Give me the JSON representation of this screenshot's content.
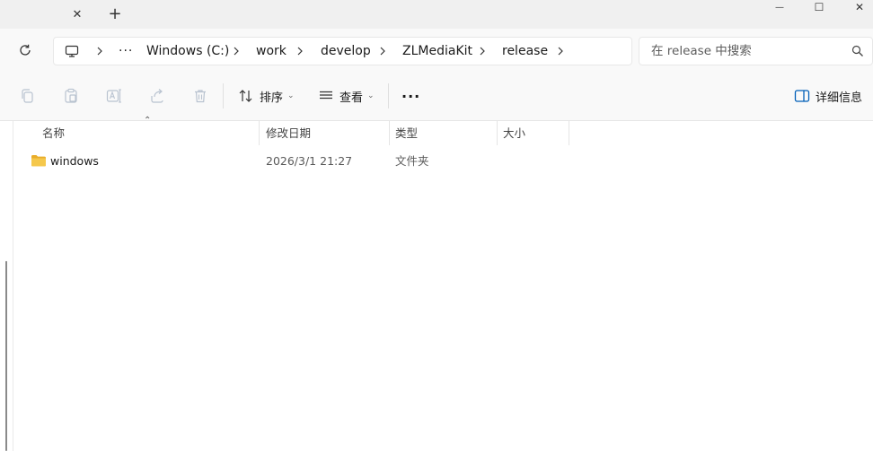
{
  "window": {
    "tab_close_glyph": "✕",
    "new_tab_glyph": "+",
    "minimize_glyph": "—",
    "maximize_glyph": "☐",
    "close_glyph": "✕"
  },
  "address": {
    "more_glyph": "···",
    "crumbs": [
      "Windows (C:)",
      "work",
      "develop",
      "ZLMediaKit",
      "release"
    ]
  },
  "search": {
    "placeholder": "在 release 中搜索"
  },
  "toolbar": {
    "sort_label": "排序",
    "view_label": "查看",
    "more_glyph": "···",
    "details_label": "详细信息"
  },
  "columns": {
    "name": "名称",
    "modified": "修改日期",
    "type": "类型",
    "size": "大小"
  },
  "files": [
    {
      "name": "windows",
      "modified": "2026/3/1 21:27",
      "type": "文件夹",
      "size": ""
    }
  ],
  "colors": {
    "folder": "#f3c246",
    "accent": "#005fb8"
  }
}
